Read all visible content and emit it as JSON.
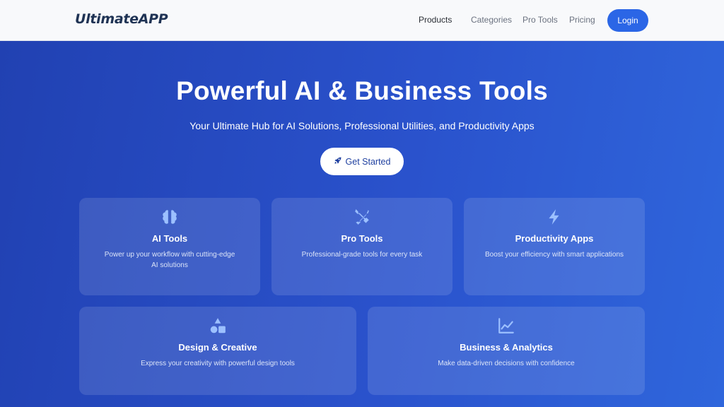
{
  "brand": {
    "name": "UltimateAPP"
  },
  "nav": {
    "items": [
      {
        "label": "Products",
        "active": true
      },
      {
        "label": "Categories",
        "active": false
      },
      {
        "label": "Pro Tools",
        "active": false
      },
      {
        "label": "Pricing",
        "active": false
      }
    ],
    "login_label": "Login"
  },
  "hero": {
    "title": "Powerful AI & Business Tools",
    "subtitle": "Your Ultimate Hub for AI Solutions, Professional Utilities, and Productivity Apps",
    "cta_label": "Get Started",
    "cta_icon": "rocket-icon"
  },
  "cards": [
    {
      "icon": "brain-icon",
      "title": "AI Tools",
      "description": "Power up your workflow with cutting-edge AI solutions"
    },
    {
      "icon": "tools-icon",
      "title": "Pro Tools",
      "description": "Professional-grade tools for every task"
    },
    {
      "icon": "bolt-icon",
      "title": "Productivity Apps",
      "description": "Boost your efficiency with smart applications"
    },
    {
      "icon": "shapes-icon",
      "title": "Design & Creative",
      "description": "Express your creativity with powerful design tools"
    },
    {
      "icon": "chart-line-icon",
      "title": "Business & Analytics",
      "description": "Make data-driven decisions with confidence"
    }
  ],
  "colors": {
    "primary": "#2b66e6",
    "hero_bg": "#2a52cc",
    "icon_color": "#9cc0ff"
  }
}
